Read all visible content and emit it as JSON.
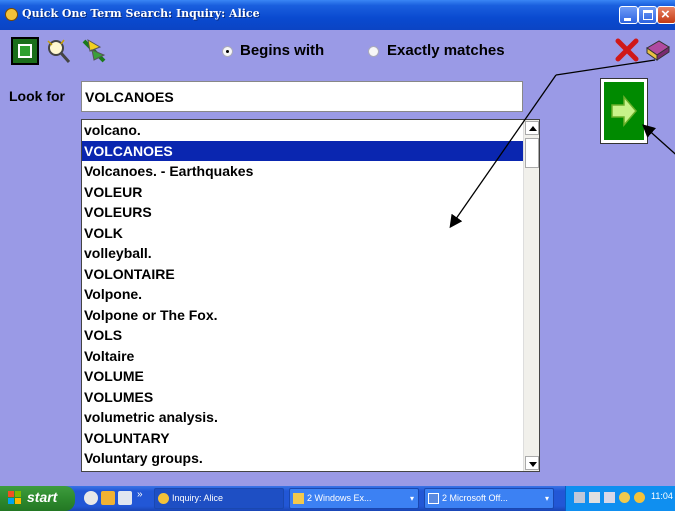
{
  "window": {
    "title": "Quick One Term Search: Inquiry: Alice"
  },
  "toolbar": {
    "search_modes": [
      {
        "label": "Begins with",
        "selected": true
      },
      {
        "label": "Exactly matches",
        "selected": false
      }
    ]
  },
  "search": {
    "label": "Look for",
    "value": "VOLCANOES"
  },
  "results": [
    {
      "text": "volcano.",
      "selected": false
    },
    {
      "text": "VOLCANOES",
      "selected": true
    },
    {
      "text": "Volcanoes. - Earthquakes",
      "selected": false
    },
    {
      "text": "VOLEUR",
      "selected": false
    },
    {
      "text": "VOLEURS",
      "selected": false
    },
    {
      "text": "VOLK",
      "selected": false
    },
    {
      "text": "volleyball.",
      "selected": false
    },
    {
      "text": "VOLONTAIRE",
      "selected": false
    },
    {
      "text": "Volpone.",
      "selected": false
    },
    {
      "text": "Volpone or The Fox.",
      "selected": false
    },
    {
      "text": "VOLS",
      "selected": false
    },
    {
      "text": "Voltaire",
      "selected": false
    },
    {
      "text": "VOLUME",
      "selected": false
    },
    {
      "text": "VOLUMES",
      "selected": false
    },
    {
      "text": "volumetric analysis.",
      "selected": false
    },
    {
      "text": "VOLUNTARY",
      "selected": false
    },
    {
      "text": "Voluntary groups.",
      "selected": false
    }
  ],
  "taskbar": {
    "start_label": "start",
    "quick_launch_more": "»",
    "tasks": [
      {
        "label": "Inquiry: Alice",
        "active": true
      },
      {
        "label": "2 Windows Ex...",
        "active": false
      },
      {
        "label": "2 Microsoft Off...",
        "active": false
      }
    ],
    "clock": "11:04"
  },
  "colors": {
    "window_bg": "#9a9ae6",
    "selection": "#0a26b0",
    "go_button": "#008a00",
    "titlebar": "#0a4ad0"
  },
  "icons": {
    "app": "app-icon",
    "toolbar": [
      "display-icon",
      "search-icon",
      "browse-icon"
    ],
    "cancel": "close-icon",
    "help": "book-icon",
    "go": "arrow-right-icon"
  }
}
